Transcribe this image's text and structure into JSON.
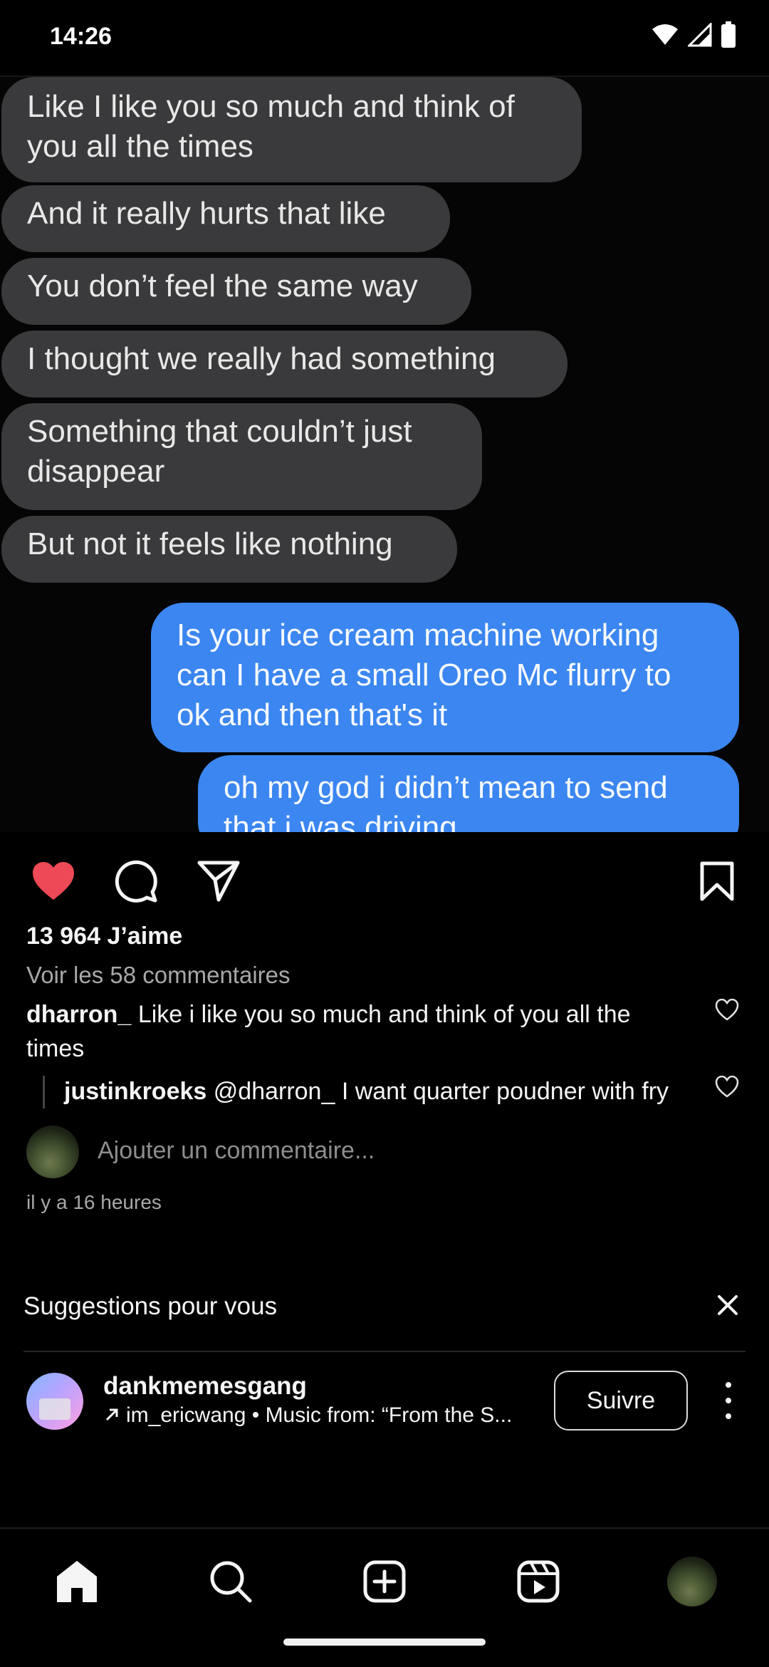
{
  "status_bar": {
    "time": "14:26",
    "icons": [
      "wifi-icon",
      "cell-signal-icon",
      "battery-icon"
    ]
  },
  "post": {
    "image_messages": [
      {
        "side": "incoming",
        "text": "Like I like you so much and think of\nyou all the times"
      },
      {
        "side": "incoming",
        "text": "And it really hurts that like"
      },
      {
        "side": "incoming",
        "text": "You don’t feel the same way"
      },
      {
        "side": "incoming",
        "text": "I thought we really had something"
      },
      {
        "side": "incoming",
        "text": "Something that couldn’t just\ndisappear"
      },
      {
        "side": "incoming",
        "text": "But not it feels like nothing"
      },
      {
        "side": "outgoing",
        "text": "Is your ice cream machine working\ncan I have a small Oreo Mc flurry to\nok and then that's it"
      },
      {
        "side": "outgoing",
        "text": "oh my god i didn’t mean to send\nthat i was driving"
      }
    ],
    "likes_text": "13 964 J’aime",
    "liked": true,
    "view_comments_text": "Voir les 58 commentaires",
    "comments": [
      {
        "user": "dharron_",
        "text": "Like i like you so much and think of you all the times"
      },
      {
        "user": "justinkroeks",
        "text": "@dharron_ I want quarter poudner with fry"
      }
    ],
    "add_comment_placeholder": "Ajouter un commentaire...",
    "timestamp": "il y a 16 heures"
  },
  "suggestions": {
    "title": "Suggestions pour vous",
    "account": {
      "username": "dankmemesgang",
      "subtitle": "im_ericwang • Music from: “From the S...",
      "follow_label": "Suivre"
    }
  },
  "colors": {
    "background": "#000000",
    "like_red": "#ed4956",
    "bubble_incoming": "#3a3a3c",
    "bubble_outgoing": "#3b86f0",
    "muted_text": "#a8a8a8"
  },
  "bottom_nav": [
    "home-icon",
    "search-icon",
    "create-icon",
    "reels-icon",
    "profile-avatar"
  ]
}
